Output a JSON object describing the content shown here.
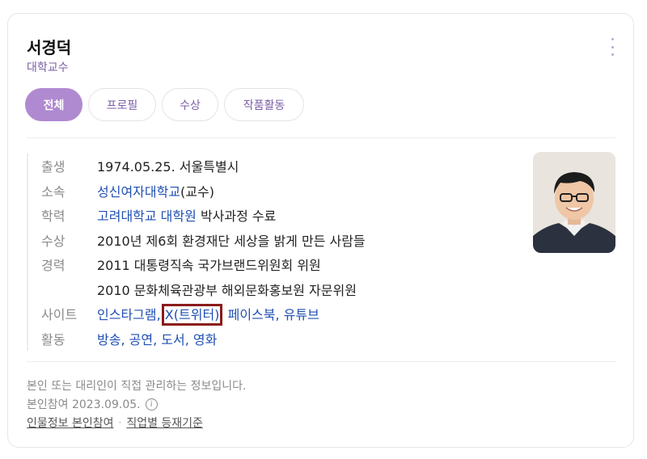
{
  "profile": {
    "name": "서경덕",
    "subtitle": "대학교수"
  },
  "tabs": [
    {
      "label": "전체",
      "active": true
    },
    {
      "label": "프로필",
      "active": false
    },
    {
      "label": "수상",
      "active": false
    },
    {
      "label": "작품활동",
      "active": false
    }
  ],
  "info": {
    "birth": {
      "label": "출생",
      "value": "1974.05.25. 서울특별시"
    },
    "affiliation": {
      "label": "소속",
      "link": "성신여자대학교",
      "suffix": "(교수)"
    },
    "education": {
      "label": "학력",
      "link": "고려대학교 대학원",
      "suffix": " 박사과정 수료"
    },
    "award": {
      "label": "수상",
      "value": "2010년 제6회 환경재단 세상을 밝게 만든 사람들"
    },
    "career": {
      "label": "경력",
      "line1": "2011 대통령직속 국가브랜드위원회 위원",
      "line2": "2010 문화체육관광부 해외문화홍보원 자문위원"
    },
    "sites": {
      "label": "사이트",
      "items": [
        "인스타그램",
        "X(트위터)",
        "페이스북",
        "유튜브"
      ],
      "separator": ","
    },
    "activities": {
      "label": "활동",
      "items": [
        "방송",
        "공연",
        "도서",
        "영화"
      ],
      "separator": ","
    }
  },
  "footer": {
    "note": "본인 또는 대리인이 직접 관리하는 정보입니다.",
    "participation": "본인참여 2023.09.05.",
    "info_icon_glyph": "i",
    "link1": "인물정보 본인참여",
    "dot": "·",
    "link2": "직업별 등재기준"
  },
  "colors": {
    "accent": "#b08ad0",
    "link": "#1f4fb3",
    "highlight_box": "#8b1a1a"
  }
}
